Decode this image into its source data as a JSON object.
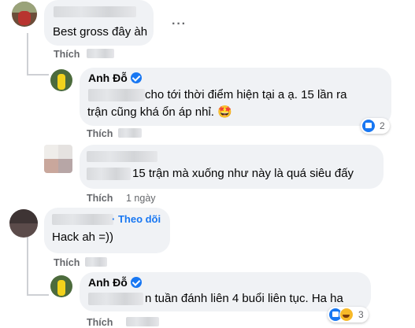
{
  "comment1": {
    "text": "Best gross đây àh",
    "like_label": "Thích",
    "more_label": "···"
  },
  "reply1": {
    "author": "Anh Đỗ",
    "text_line1": "cho tới thời điểm hiện tại a ạ. 15 lần ra",
    "text_line2": "trận cũng khá ổn áp nhỉ. 🤩",
    "like_label": "Thích",
    "reaction_count": "2"
  },
  "reply2": {
    "text": "15 trận mà xuống như này là quá siêu đấy",
    "like_label": "Thích",
    "time": "1 ngày"
  },
  "comment2": {
    "follow_label": "Theo dõi",
    "text": "Hack ah =))",
    "like_label": "Thích"
  },
  "reply3": {
    "author": "Anh Đỗ",
    "text": "n tuần đánh liên 4 buổi liên tục. Ha ha",
    "like_label": "Thích",
    "reaction_count": "3"
  },
  "colors": {
    "like_blue": "#1877f2",
    "haha_yellow": "#f7b928",
    "bubble": "#f0f2f5"
  }
}
